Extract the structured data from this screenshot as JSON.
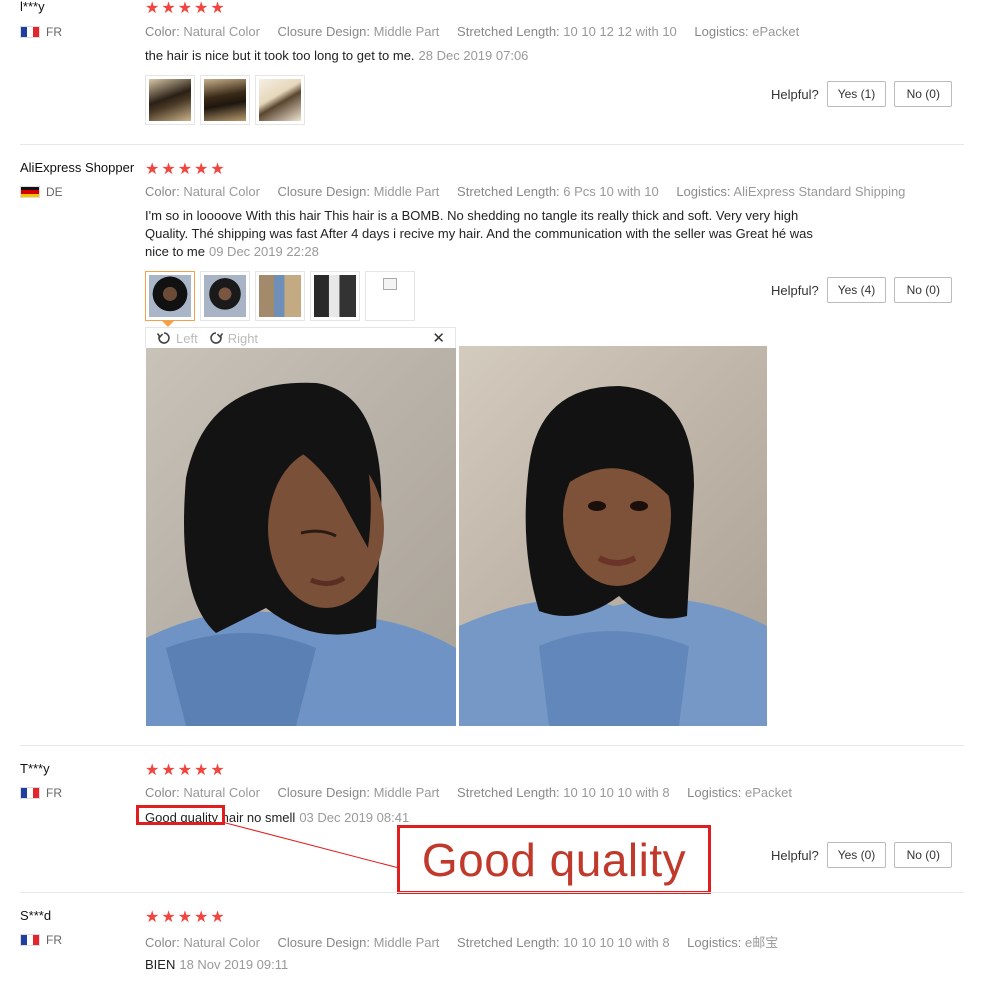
{
  "stars": "★★★★★",
  "labels": {
    "color": "Color:",
    "closure": "Closure Design:",
    "stretched": "Stretched Length:",
    "logistics": "Logistics:",
    "helpful": "Helpful?"
  },
  "reviews": [
    {
      "user": "l***y",
      "country": "FR",
      "color": "Natural Color",
      "closure": "Middle Part",
      "stretched": "10 10 12 12 with 10",
      "logistics": "ePacket",
      "text": "the hair is nice but it took too long to get to me.",
      "date": "28 Dec 2019 07:06",
      "yes": "Yes (1)",
      "no": "No (0)"
    },
    {
      "user": "AliExpress Shopper",
      "country": "DE",
      "color": "Natural Color",
      "closure": "Middle Part",
      "stretched": "6 Pcs 10 with 10",
      "logistics": "AliExpress Standard Shipping",
      "text_line1": "I'm so in loooove With this hair This hair is a BOMB. No shedding no tangle its really thick and soft. Very very high",
      "text_line2": "Quality. Thé shipping was fast After 4 days i recive my hair. And the communication with the seller was Great hé was",
      "text_line3": "nice to me",
      "date": "09 Dec 2019 22:28",
      "yes": "Yes (4)",
      "no": "No (0)"
    },
    {
      "user": "T***y",
      "country": "FR",
      "color": "Natural Color",
      "closure": "Middle Part",
      "stretched": "10 10 10 10 with 8",
      "logistics": "ePacket",
      "text_hl": "Good quality",
      "text_rest": " hair no smell",
      "date": "03 Dec 2019 08:41",
      "yes": "Yes (0)",
      "no": "No (0)"
    },
    {
      "user": "S***d",
      "country": "FR",
      "color": "Natural Color",
      "closure": "Middle Part",
      "stretched": "10 10 10 10 with 8",
      "logistics": "e邮宝",
      "text": "BIEN",
      "date": "18 Nov 2019 09:11"
    }
  ],
  "viewer": {
    "left": "Left",
    "right": "Right",
    "close": "✕"
  },
  "annotation": {
    "callout": "Good quality",
    "color": "#e01e1e"
  }
}
